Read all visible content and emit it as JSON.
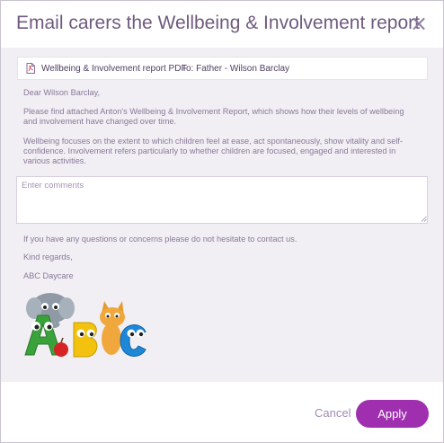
{
  "dialog": {
    "title": "Email carers the Wellbeing & Involvement report",
    "close_icon": "×"
  },
  "attachment": {
    "icon": "pdf-file-icon",
    "name": "Wellbeing & Involvement report PDF",
    "recipient": "To: Father - Wilson Barclay"
  },
  "message": {
    "greeting": "Dear Wilson Barclay,",
    "paragraph1": "Please find attached Anton's Wellbeing & Involvement Report, which shows how their levels of wellbeing and involvement have changed over time.",
    "paragraph2": "Wellbeing focuses on the extent to which children feel at ease, act spontaneously, show vitality and self-confidence. Involvement refers particularly to whether children are focused, engaged and interested in various activities.",
    "comments_placeholder": "Enter comments",
    "closing1": "If you have any questions or concerns please do not hesitate to contact us.",
    "closing2": "Kind regards,",
    "signature": "ABC Daycare"
  },
  "logo": {
    "letters": [
      "A",
      "B",
      "C"
    ],
    "colors": {
      "A": "#3aa23a",
      "B": "#f2c20f",
      "C": "#1e88d8"
    }
  },
  "footer": {
    "cancel_label": "Cancel",
    "apply_label": "Apply",
    "accent": "#a02fb0"
  }
}
